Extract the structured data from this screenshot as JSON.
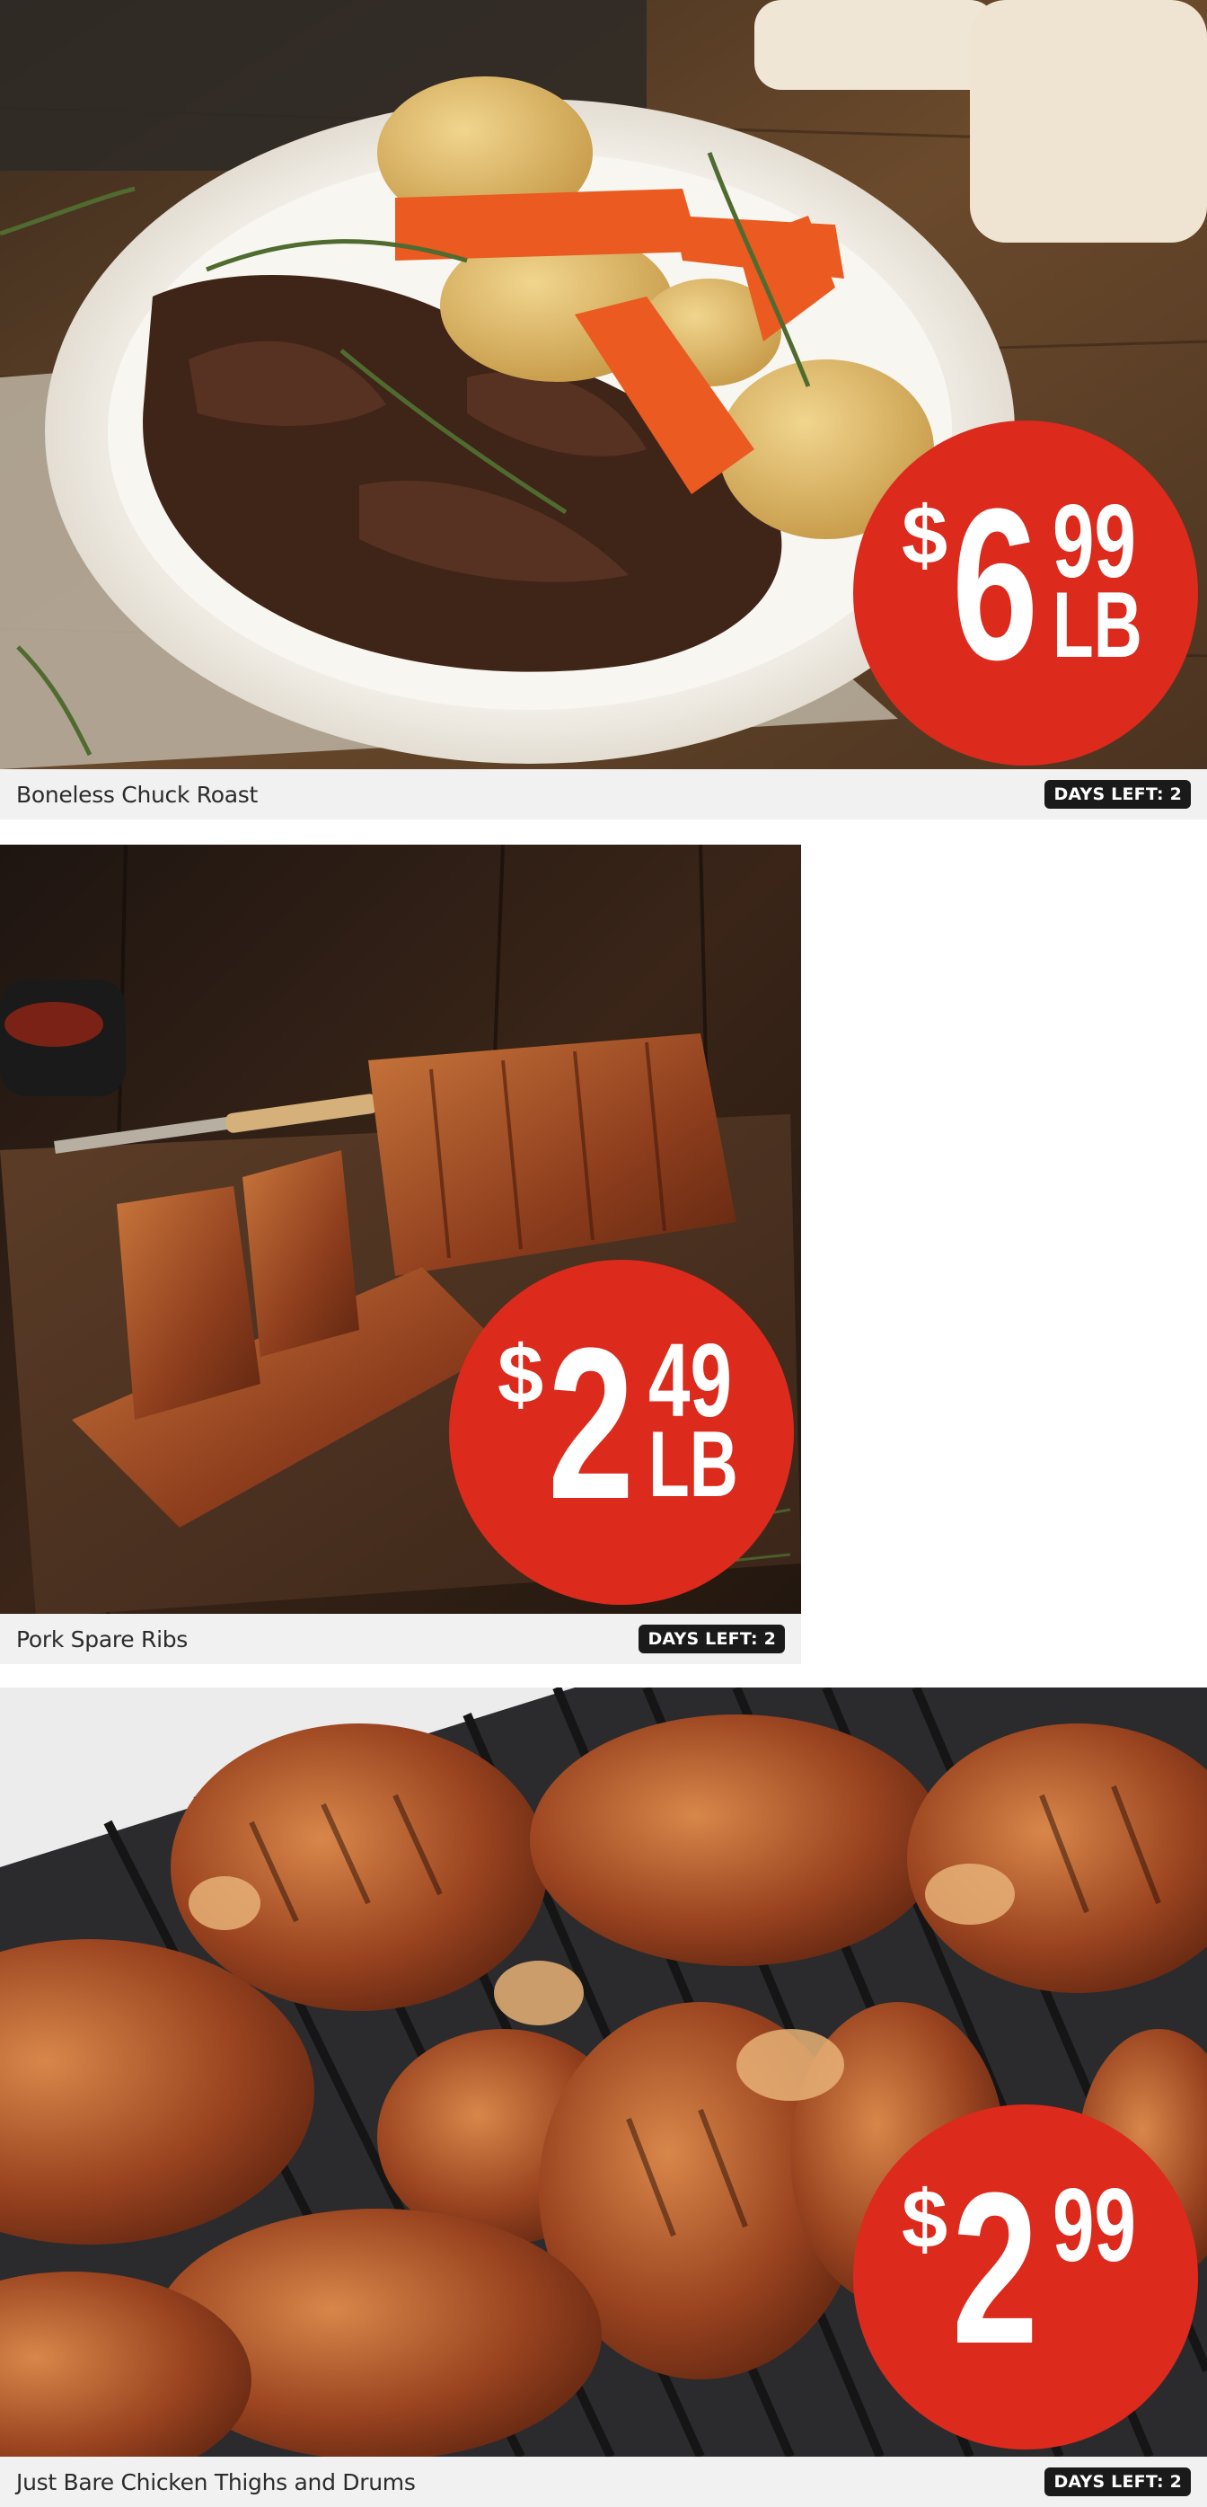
{
  "products": [
    {
      "name": "Boneless Chuck Roast",
      "days_left": "DAYS LEFT: 2",
      "price": {
        "dollar_sign": "$",
        "whole": "6",
        "cents": "99",
        "unit": "LB"
      }
    },
    {
      "name": "Pork Spare Ribs",
      "days_left": "DAYS LEFT: 2",
      "price": {
        "dollar_sign": "$",
        "whole": "2",
        "cents": "49",
        "unit": "LB"
      }
    },
    {
      "name": "Just Bare Chicken Thighs and Drums",
      "days_left": "DAYS LEFT: 2",
      "price": {
        "dollar_sign": "$",
        "whole": "2",
        "cents": "99",
        "unit": ""
      }
    }
  ],
  "colors": {
    "price_badge": "#dc2a1c",
    "caption_bg": "#f1f1f1",
    "days_badge_bg": "#1a1a1a"
  }
}
